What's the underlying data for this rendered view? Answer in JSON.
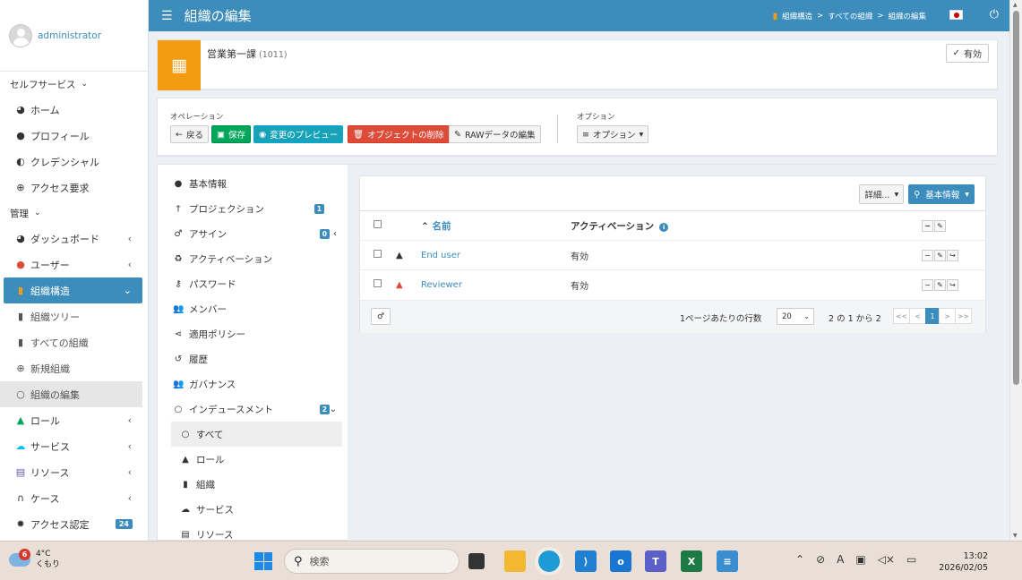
{
  "header": {
    "title": "組織の編集",
    "breadcrumb": [
      "組織構造",
      "すべての組織",
      "組織の編集"
    ],
    "breadcrumb_sep": ">"
  },
  "sidebar": {
    "user": "administrator",
    "sections": [
      {
        "label": "セルフサービス"
      },
      {
        "label": "管理"
      }
    ],
    "self_items": [
      {
        "label": "ホーム",
        "icon": "dashboard-icon"
      },
      {
        "label": "プロフィール",
        "icon": "user-icon"
      },
      {
        "label": "クレデンシャル",
        "icon": "shield-icon"
      },
      {
        "label": "アクセス要求",
        "icon": "plus-circle-icon"
      }
    ],
    "admin_items": [
      {
        "label": "ダッシュボード"
      },
      {
        "label": "ユーザー"
      },
      {
        "label": "組織構造"
      },
      {
        "label": "組織ツリー"
      },
      {
        "label": "すべての組織"
      },
      {
        "label": "新規組織"
      },
      {
        "label": "組織の編集"
      },
      {
        "label": "ロール"
      },
      {
        "label": "サービス"
      },
      {
        "label": "リソース"
      },
      {
        "label": "ケース"
      },
      {
        "label": "アクセス認定",
        "badge": "24"
      }
    ]
  },
  "object": {
    "name": "営業第一課",
    "code": "(1011)",
    "status": "有効"
  },
  "operations": {
    "label": "オペレーション",
    "back": "戻る",
    "save": "保存",
    "preview": "変更のプレビュー",
    "delete": "オブジェクトの削除",
    "raw": "RAWデータの編集",
    "options_label": "オプション",
    "options_btn": "オプション"
  },
  "tree": {
    "items": [
      {
        "label": "基本情報"
      },
      {
        "label": "プロジェクション",
        "badge": "1"
      },
      {
        "label": "アサイン",
        "badge": "0"
      },
      {
        "label": "アクティベーション"
      },
      {
        "label": "パスワード"
      },
      {
        "label": "メンバー"
      },
      {
        "label": "適用ポリシー"
      },
      {
        "label": "履歴"
      },
      {
        "label": "ガバナンス"
      },
      {
        "label": "インデュースメント",
        "badge": "2"
      },
      {
        "label": "すべて"
      },
      {
        "label": "ロール"
      },
      {
        "label": "組織"
      },
      {
        "label": "サービス"
      },
      {
        "label": "リソース"
      }
    ]
  },
  "table": {
    "detail_btn": "詳細...",
    "basic_btn": "基本情報",
    "col_name": "名前",
    "col_activation": "アクティベーション",
    "rows": [
      {
        "name": "End user",
        "activation": "有効"
      },
      {
        "name": "Reviewer",
        "activation": "有効"
      }
    ],
    "rows_per_page_label": "1ページあたりの行数",
    "rows_per_page": "20",
    "count_text": "2 の 1 から 2",
    "pager": [
      "<<",
      "<",
      "1",
      ">",
      ">>"
    ]
  },
  "taskbar": {
    "weather_badge": "6",
    "temp": "4°C",
    "condition": "くもり",
    "search_placeholder": "検索",
    "time": "13:02",
    "date": "2026/02/05"
  },
  "colors": {
    "primary": "#3c8dbc",
    "org_icon": "#f39c12",
    "save": "#00a65a",
    "danger": "#dd4b39"
  }
}
